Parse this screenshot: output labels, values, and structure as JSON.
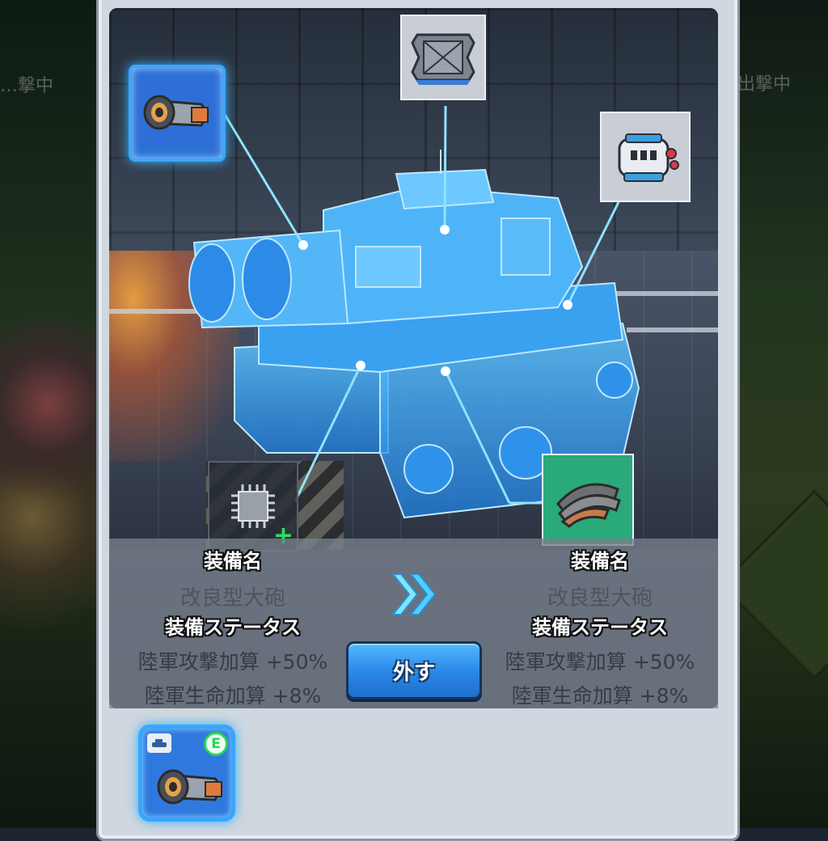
{
  "background": {
    "left_text": "…撃中",
    "right_text": "出撃中"
  },
  "slots": [
    {
      "id": "cannon",
      "icon": "cannon-icon",
      "state": "selected"
    },
    {
      "id": "armor-plate",
      "icon": "armor-plate-icon",
      "state": "filled"
    },
    {
      "id": "engine",
      "icon": "engine-icon",
      "state": "filled"
    },
    {
      "id": "chip",
      "icon": "chip-icon",
      "state": "empty",
      "add_symbol": "+"
    },
    {
      "id": "track",
      "icon": "track-icon",
      "state": "filled"
    }
  ],
  "current": {
    "equip_label": "装備名",
    "equip_name": "改良型大砲",
    "status_label": "装備ステータス",
    "stats": [
      "陸軍攻撃加算 +50%",
      "陸軍生命加算 +8%"
    ]
  },
  "compare_arrow": "next-chevrons-icon",
  "candidate": {
    "equip_label": "装備名",
    "equip_name": "改良型大砲",
    "status_label": "装備ステータス",
    "stats": [
      "陸軍攻撃加算 +50%",
      "陸軍生命加算 +8%"
    ]
  },
  "remove_button": {
    "label": "外す"
  },
  "inventory": [
    {
      "icon": "cannon-icon",
      "type_badge": "tank-type-icon",
      "equipped_badge": "E"
    }
  ],
  "colors": {
    "accent_blue": "#38a6ff",
    "hologram": "#4fb8ff",
    "equipped_green": "#2ad25a",
    "track_slot_green": "#2aa97a"
  }
}
